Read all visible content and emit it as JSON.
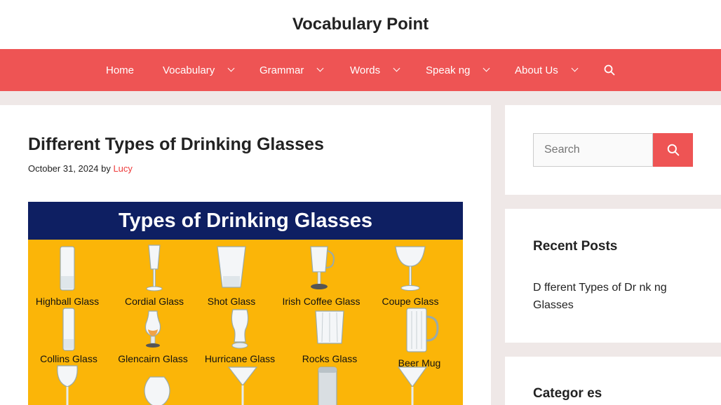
{
  "site": {
    "title": "Vocabulary Point"
  },
  "nav": {
    "items": [
      {
        "label": "Home",
        "has_dropdown": false
      },
      {
        "label": "Vocabulary",
        "has_dropdown": true
      },
      {
        "label": "Grammar",
        "has_dropdown": true
      },
      {
        "label": "Words",
        "has_dropdown": true
      },
      {
        "label": "Speak ng",
        "has_dropdown": true
      },
      {
        "label": "About Us",
        "has_dropdown": true
      }
    ],
    "search_icon": "search-icon"
  },
  "post": {
    "title": "Different Types of Drinking Glasses",
    "date": "October 31, 2024",
    "by": "by",
    "author": "Lucy",
    "image": {
      "banner": "Types of Drinking Glasses",
      "glasses": [
        "Highball Glass",
        "Cordial Glass",
        "Shot Glass",
        "Irish Coffee Glass",
        "Coupe Glass",
        "Collins Glass",
        "Glencairn Glass",
        "Hurricane Glass",
        "Rocks Glass",
        "Beer Mug"
      ]
    }
  },
  "sidebar": {
    "search": {
      "placeholder": "Search"
    },
    "recent": {
      "title": "Recent Posts",
      "posts": [
        "D fferent Types of Dr nk ng Glasses"
      ]
    },
    "categories": {
      "title": "Categor es"
    }
  },
  "colors": {
    "accent": "#ee5454",
    "banner": "#0e1f62",
    "image_bg": "#fbb508",
    "page_bg": "#efe8e7"
  }
}
